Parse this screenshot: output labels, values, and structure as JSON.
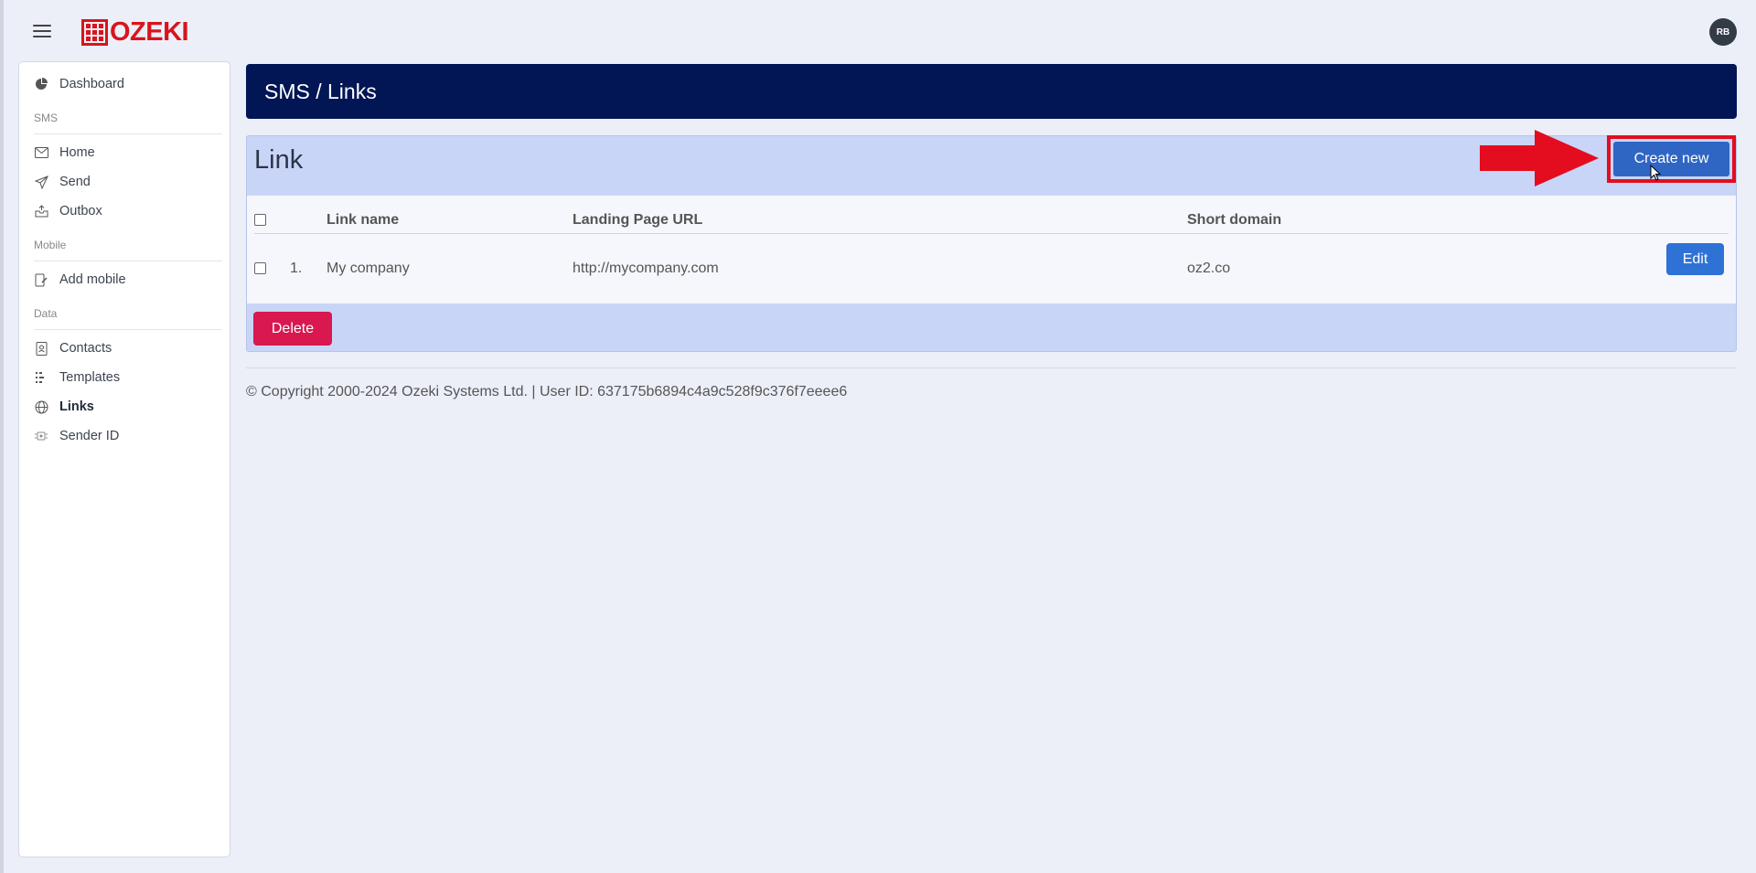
{
  "app": {
    "logo_text": "OZEKI",
    "avatar_initials": "RB",
    "brand_color": "#d8141c"
  },
  "sidebar": {
    "dashboard": "Dashboard",
    "sections": {
      "sms": "SMS",
      "mobile": "Mobile",
      "data": "Data"
    },
    "items": {
      "home": "Home",
      "send": "Send",
      "outbox": "Outbox",
      "add_mobile": "Add mobile",
      "contacts": "Contacts",
      "templates": "Templates",
      "links": "Links",
      "sender_id": "Sender ID"
    },
    "active": "Links"
  },
  "header": {
    "title": "SMS / Links",
    "bg_color": "#021555"
  },
  "panel": {
    "title": "Link",
    "create_label": "Create new",
    "delete_label": "Delete",
    "columns": {
      "link_name": "Link name",
      "landing_url": "Landing Page URL",
      "short_domain": "Short domain"
    },
    "rows": [
      {
        "index": "1.",
        "link_name": "My company",
        "landing_url": "http://mycompany.com",
        "short_domain": "oz2.co",
        "action": "Edit"
      }
    ]
  },
  "footer": {
    "text": "© Copyright 2000-2024 Ozeki Systems Ltd. | User ID: 637175b6894c4a9c528f9c376f7eeee6"
  }
}
